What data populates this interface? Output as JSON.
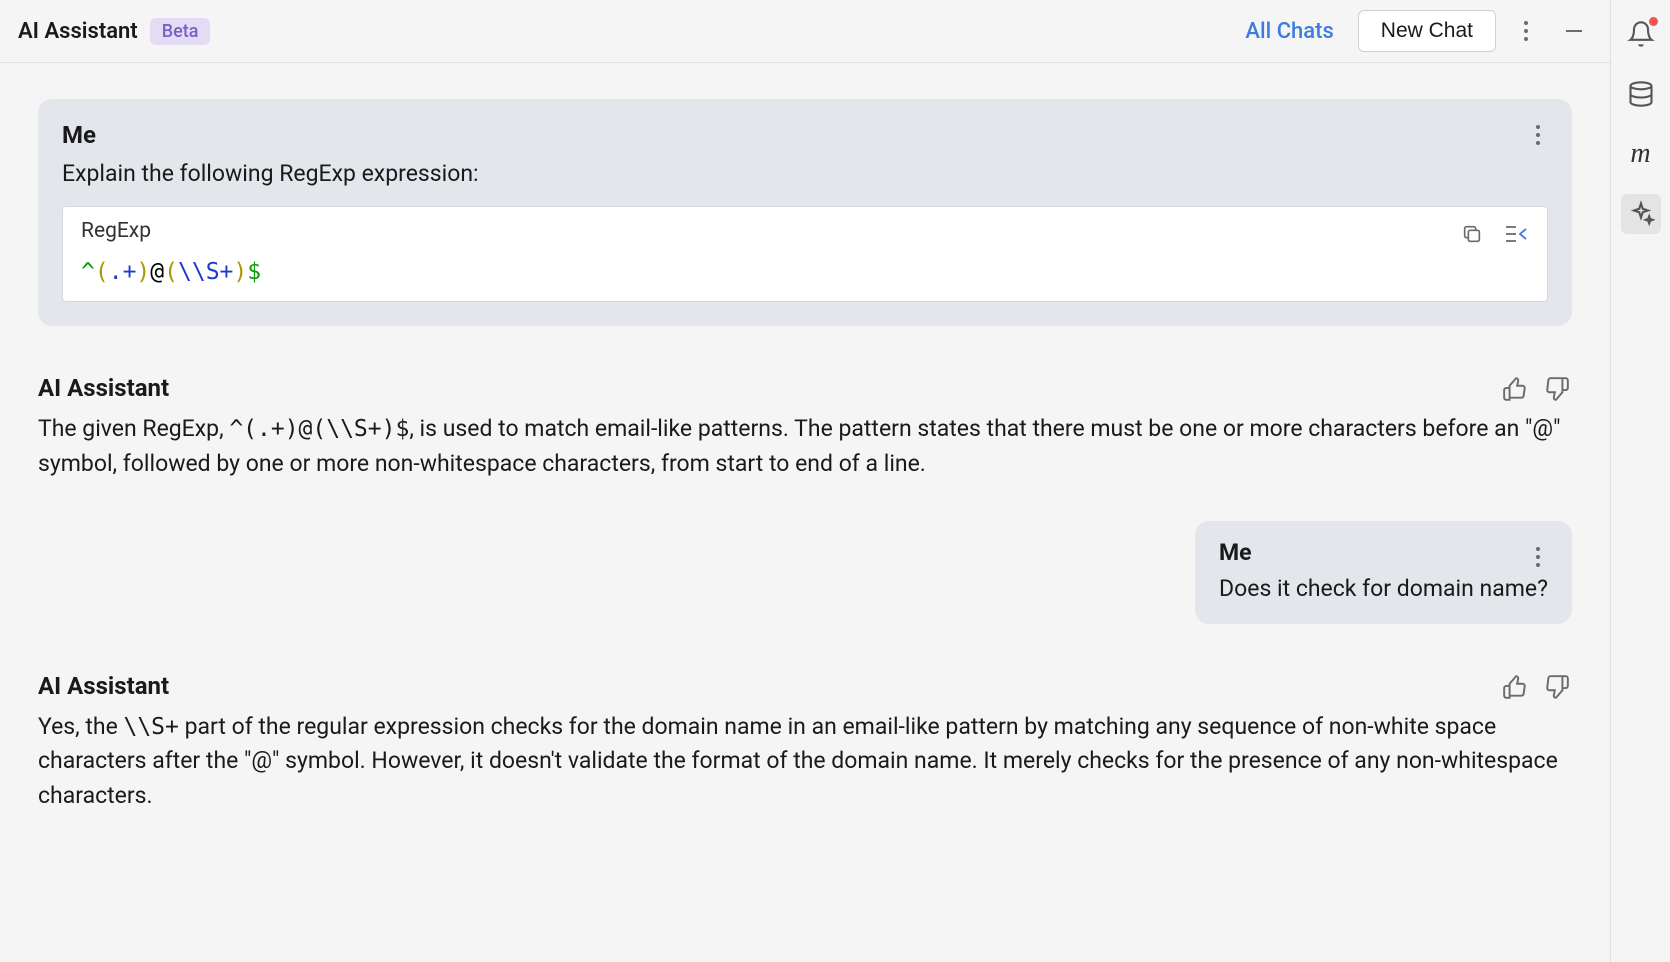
{
  "header": {
    "title": "AI Assistant",
    "badge": "Beta",
    "all_chats": "All Chats",
    "new_chat": "New Chat"
  },
  "conversation": {
    "msg1": {
      "author": "Me",
      "text": "Explain the following RegExp expression:",
      "code_label": "RegExp",
      "code": "^(.+)@(\\\\S+)$"
    },
    "resp1": {
      "author": "AI Assistant",
      "text_a": "The given RegExp, ",
      "code_inline": "^(.+)@(\\\\S+)$",
      "text_b": ", is used to match email-like patterns. The pattern states that there must be one or more characters before an \"@\" symbol, followed by one or more non-whitespace characters, from start to end of a line."
    },
    "msg2": {
      "author": "Me",
      "text": "Does it check for domain name?"
    },
    "resp2": {
      "author": "AI Assistant",
      "text_a": "Yes, the ",
      "code_inline": "\\\\S+",
      "text_b": " part of the regular expression checks for the domain name in an email-like pattern by matching any sequence of non-white space characters after the \"@\" symbol. However, it doesn't validate the format of the domain name. It merely checks for the presence of any non-whitespace characters."
    }
  },
  "rail": {
    "m_label": "m"
  }
}
